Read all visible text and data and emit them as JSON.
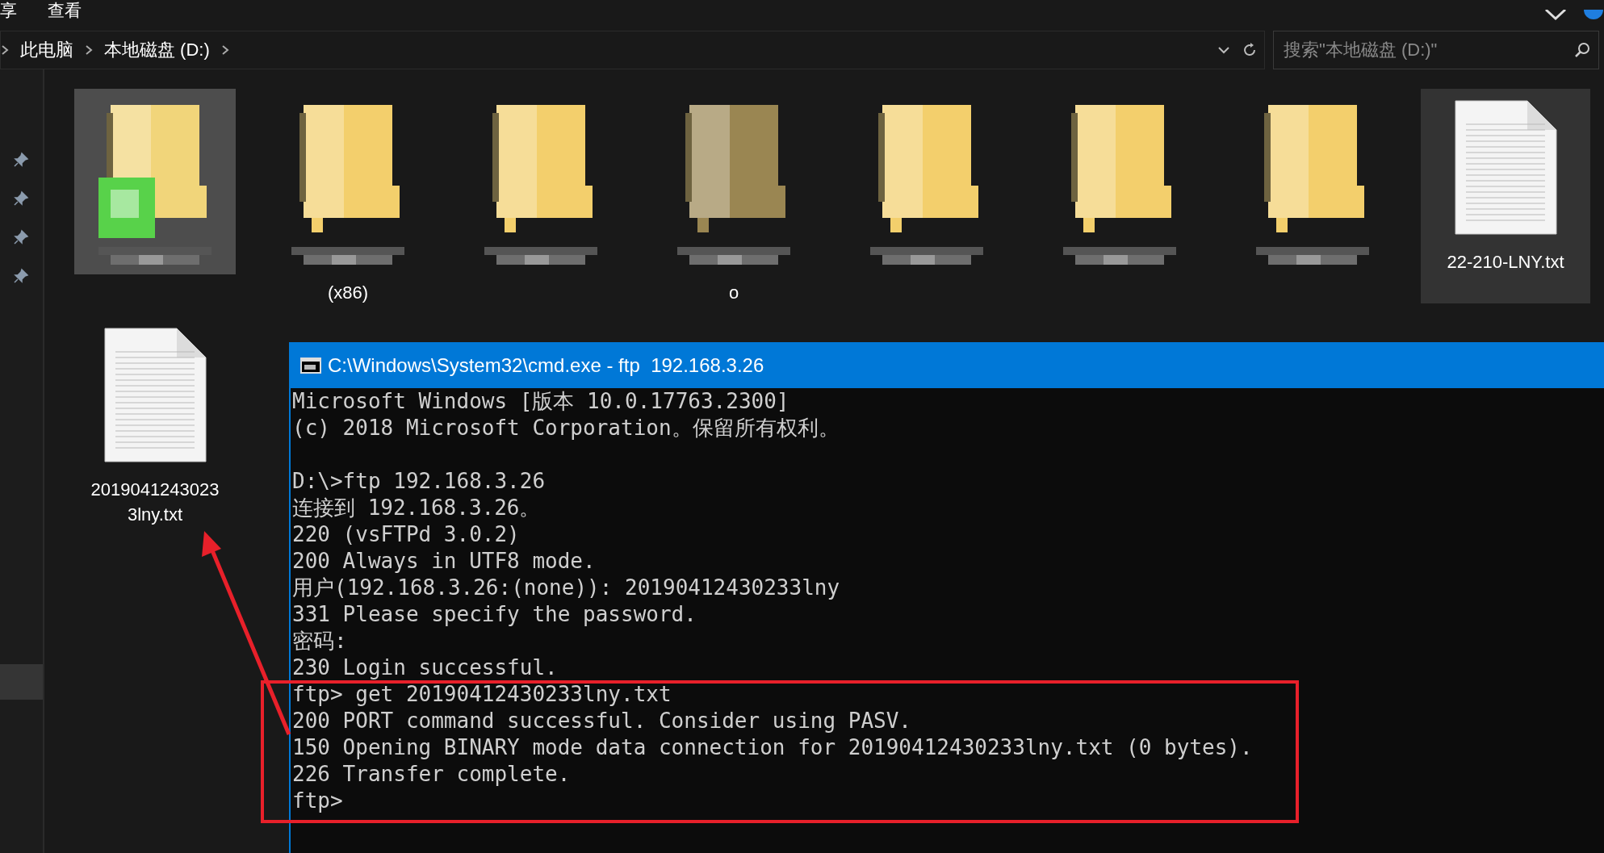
{
  "ribbon_tabs": [
    {
      "label": "享"
    },
    {
      "label": "查看"
    }
  ],
  "breadcrumb": [
    "此电脑",
    "本地磁盘 (D:)"
  ],
  "search": {
    "placeholder": "搜索\"本地磁盘 (D:)\""
  },
  "nav_pane": {
    "pins": [
      {
        "kind": "pin"
      },
      {
        "kind": "pin"
      },
      {
        "kind": "pin"
      },
      {
        "kind": "pin"
      }
    ],
    "highlight": {
      "selected": true
    }
  },
  "files": [
    {
      "kind": "badged",
      "color": "#f1d57a",
      "selected": true
    },
    {
      "kind": "picture",
      "color": "#f3cf6c",
      "selected": false,
      "caption": "(x86)"
    },
    {
      "kind": "picture",
      "color": "#f3cf6c",
      "selected": false
    },
    {
      "kind": "picture",
      "color": "#9a8652",
      "selected": false,
      "caption": "o"
    },
    {
      "kind": "picture",
      "color": "#f3cf6c",
      "selected": false
    },
    {
      "kind": "picture",
      "color": "#f3cf6c",
      "selected": false
    },
    {
      "kind": "picture",
      "color": "#f3cf6c",
      "selected": false
    },
    {
      "kind": "text-file",
      "name": "22-210-LNY.txt",
      "selected": true
    },
    {
      "kind": "text-file",
      "name": "20190412430233lny.txt",
      "selected": false
    }
  ],
  "terminal": {
    "title": "C:\\Windows\\System32\\cmd.exe - ftp  192.168.3.26",
    "blocks": [
      [
        "Microsoft Windows [版本 10.0.17763.2300]",
        "(c) 2018 Microsoft Corporation。保留所有权利。"
      ],
      [
        "D:\\>ftp 192.168.3.26",
        "连接到 192.168.3.26。",
        "220 (vsFTPd 3.0.2)",
        "200 Always in UTF8 mode.",
        "用户(192.168.3.26:(none)): 20190412430233lny",
        "331 Please specify the password.",
        "密码:",
        "230 Login successful.",
        "ftp> get 20190412430233lny.txt",
        "200 PORT command successful. Consider using PASV.",
        "150 Opening BINARY mode data connection for 20190412430233lny.txt (0 bytes).",
        "226 Transfer complete.",
        "ftp>"
      ]
    ]
  }
}
